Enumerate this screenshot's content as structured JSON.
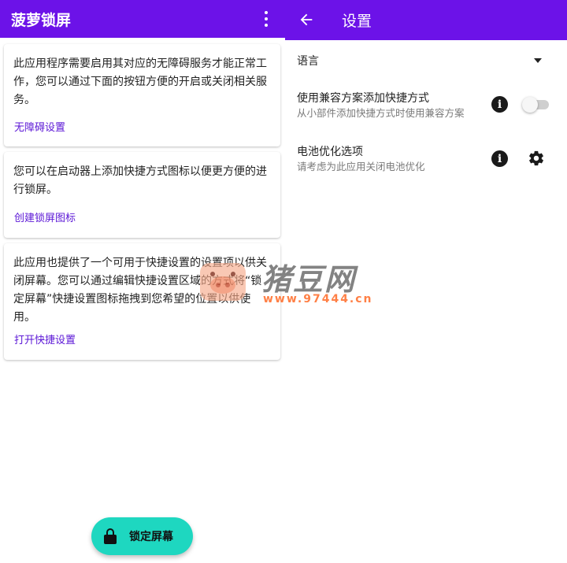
{
  "left": {
    "app_title": "菠萝锁屏",
    "menu_icon": "more-vert-icon",
    "cards": [
      {
        "text": "此应用程序需要启用其对应的无障碍服务才能正常工作，您可以通过下面的按钮方便的开启或关闭相关服务。",
        "link": "无障碍设置"
      },
      {
        "text": "您可以在启动器上添加快捷方式图标以便更方便的进行锁屏。",
        "link": "创建锁屏图标"
      },
      {
        "text": "此应用也提供了一个可用于快捷设置的设置项以供关闭屏幕。您可以通过编辑快捷设置区域的方式将“锁定屏幕”快捷设置图标拖拽到您希望的位置以供使用。",
        "link": "打开快捷设置"
      }
    ],
    "fab": {
      "icon": "lock-icon",
      "label": "锁定屏幕"
    }
  },
  "right": {
    "title": "设置",
    "back_icon": "arrow-back-icon",
    "language": {
      "label": "语言",
      "icon": "dropdown-arrow-icon"
    },
    "compat_shortcut": {
      "title": "使用兼容方案添加快捷方式",
      "subtitle": "从小部件添加快捷方式时使用兼容方案",
      "enabled": false
    },
    "battery": {
      "title": "电池优化选项",
      "subtitle": "请考虑为此应用关闭电池优化"
    }
  },
  "watermark": {
    "text": "猪豆网",
    "url": "www.97444.cn"
  },
  "colors": {
    "app_bar": "#6c12e8",
    "link": "#5b16d6",
    "fab": "#1ed7c0",
    "watermark_url": "#ff6a26"
  }
}
